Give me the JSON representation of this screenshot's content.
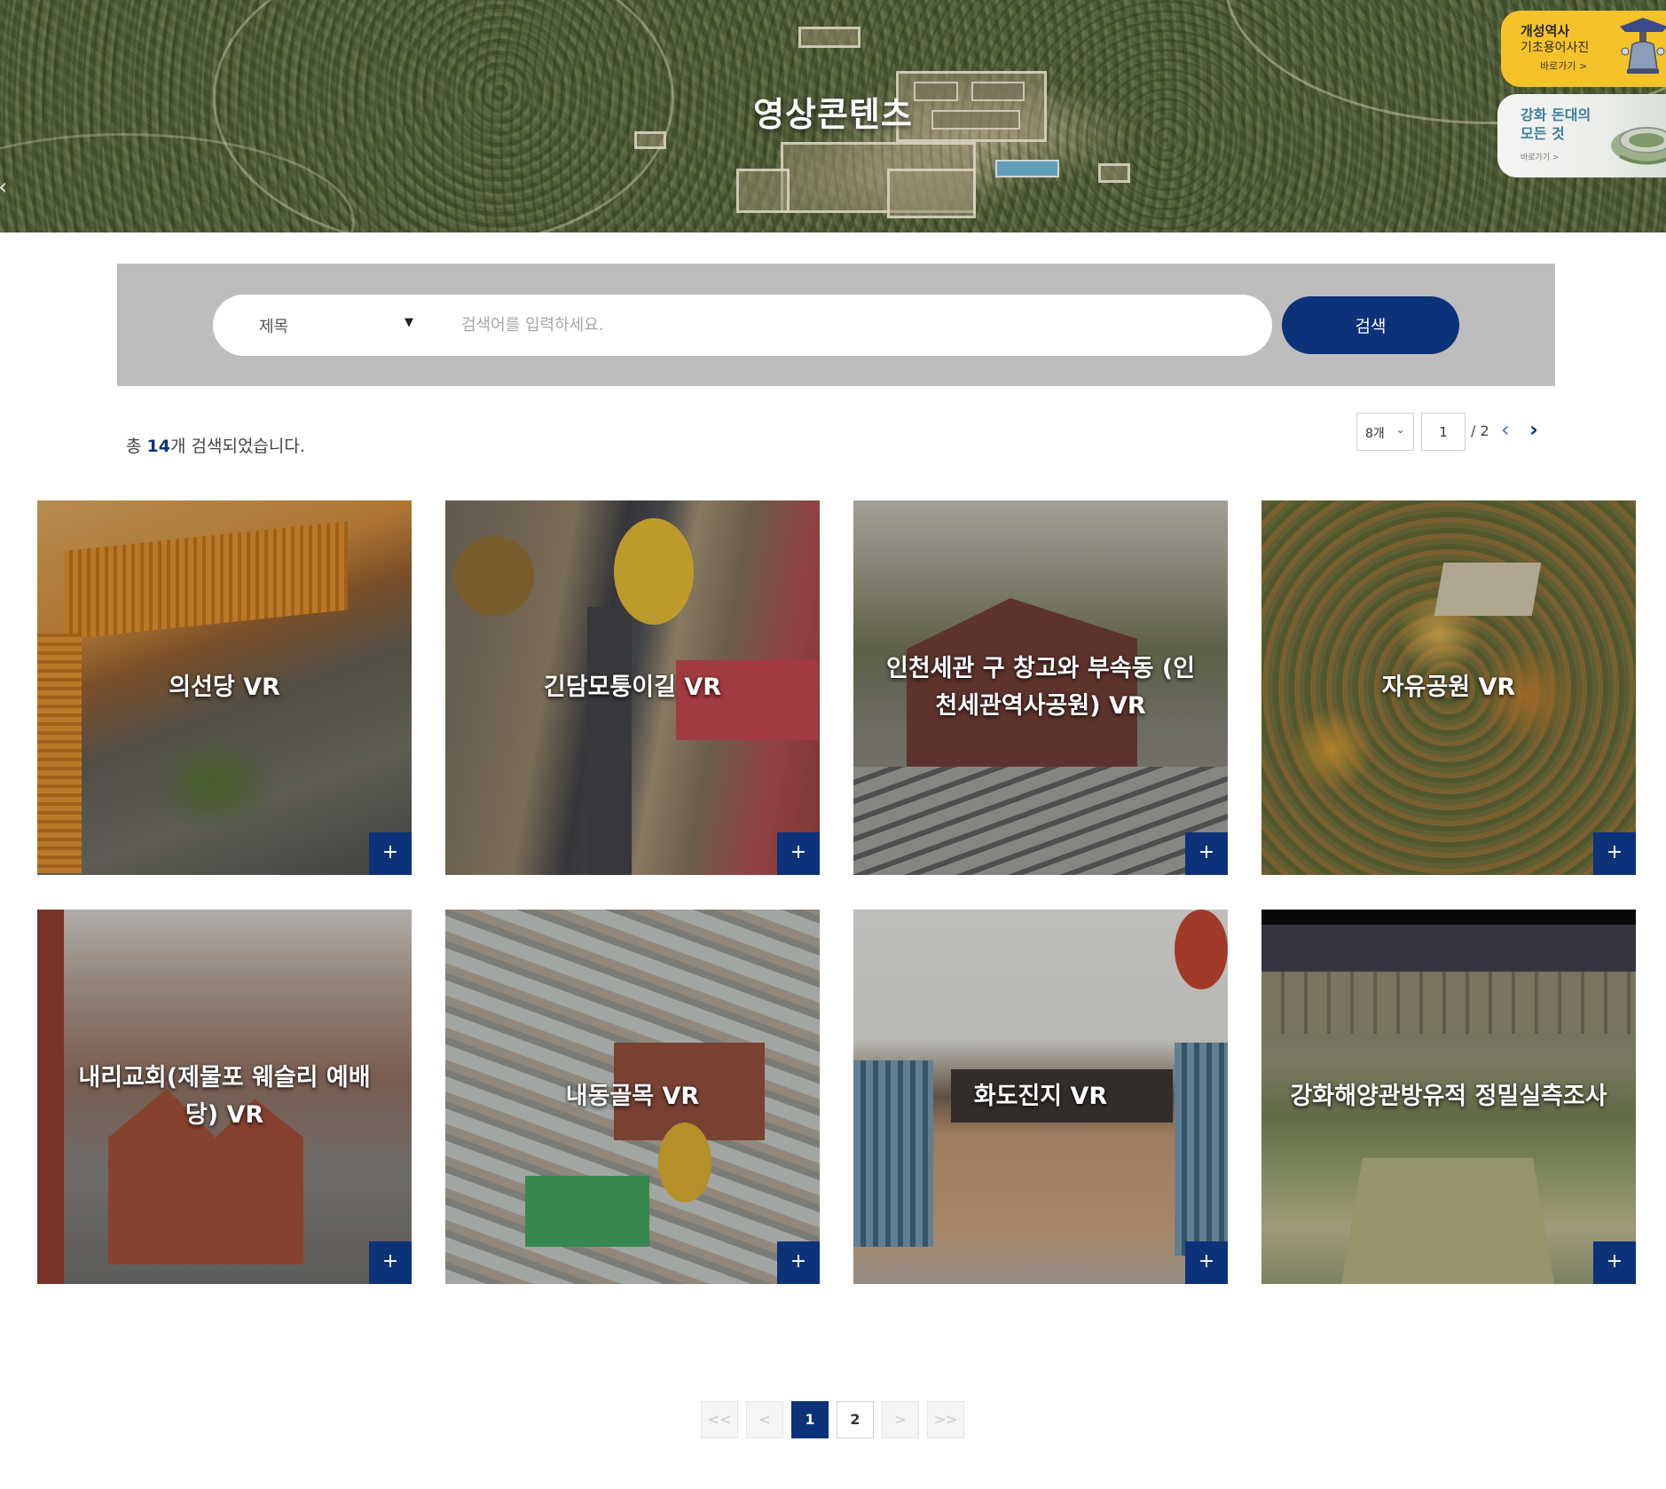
{
  "hero": {
    "title": "영상콘텐츠"
  },
  "side_banners": [
    {
      "line1": "개성역사",
      "line2": "기초용어사진",
      "link": "바로가기 >",
      "color": "#f6c22a",
      "icon": "bell-icon"
    },
    {
      "line1": "강화 돈대의",
      "line2": "모든 것",
      "link": "바로가기 >",
      "color": "#3a7fa0",
      "icon": "fort-icon"
    }
  ],
  "search": {
    "category_selected": "제목",
    "placeholder": "검색어를 입력하세요.",
    "button_label": "검색"
  },
  "results": {
    "prefix": "총 ",
    "count": "14",
    "suffix": "개 검색되었습니다."
  },
  "paging_top": {
    "per_page": "8개",
    "current_page": "1",
    "total_pages": "/ 2"
  },
  "cards": [
    {
      "title": "의선당 VR"
    },
    {
      "title": "긴담모퉁이길 VR"
    },
    {
      "title": "인천세관 구 창고와 부속동 (인천세관역사공원) VR"
    },
    {
      "title": "자유공원 VR"
    },
    {
      "title": "내리교회(제물포 웨슬리 예배당) VR"
    },
    {
      "title": "내동골목 VR"
    },
    {
      "title": "화도진지 VR"
    },
    {
      "title": "강화해양관방유적 정밀실측조사"
    }
  ],
  "pagination": {
    "first": "<<",
    "prev": "<",
    "pages": [
      "1",
      "2"
    ],
    "active_page": "1",
    "next": ">",
    "last": ">>"
  },
  "colors": {
    "primary": "#0c3279",
    "search_bg": "#bdbdbd",
    "banner_yellow": "#f6c22a"
  }
}
